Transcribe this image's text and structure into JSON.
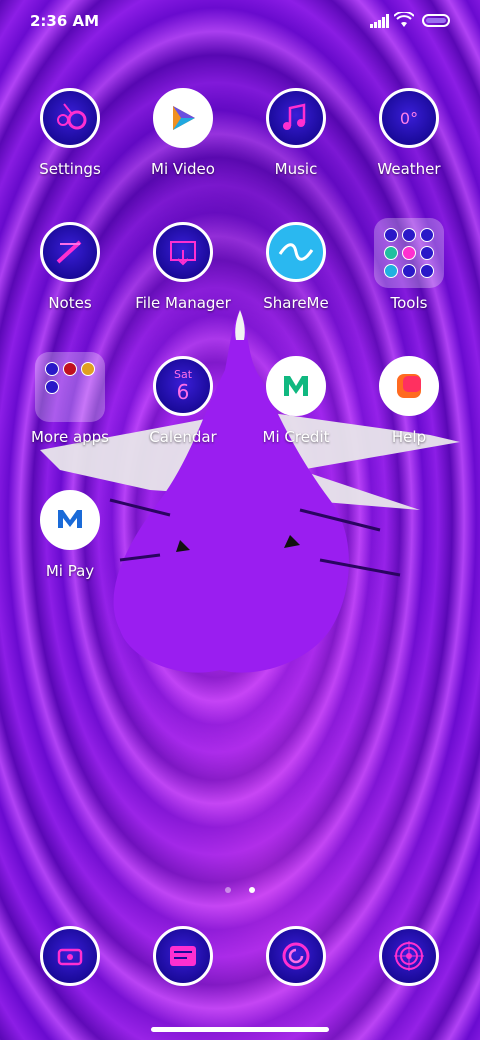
{
  "status_bar": {
    "time": "2:36 AM"
  },
  "apps_row1": [
    {
      "label": "Settings",
      "icon": "settings-icon"
    },
    {
      "label": "Mi Video",
      "icon": "mi-video-icon"
    },
    {
      "label": "Music",
      "icon": "music-icon"
    },
    {
      "label": "Weather",
      "icon": "weather-icon",
      "icon_text": "0°"
    }
  ],
  "apps_row2": [
    {
      "label": "Notes",
      "icon": "notes-icon"
    },
    {
      "label": "File Manager",
      "icon": "file-manager-icon"
    },
    {
      "label": "ShareMe",
      "icon": "shareme-icon"
    },
    {
      "label": "Tools",
      "icon": "folder-icon"
    }
  ],
  "apps_row3": [
    {
      "label": "More apps",
      "icon": "folder-icon"
    },
    {
      "label": "Calendar",
      "icon": "calendar-icon",
      "icon_day": "Sat",
      "icon_date": "6"
    },
    {
      "label": "Mi Credit",
      "icon": "mi-credit-icon"
    },
    {
      "label": "Help",
      "icon": "help-icon"
    }
  ],
  "apps_row4": [
    {
      "label": "Mi Pay",
      "icon": "mi-pay-icon"
    }
  ],
  "page_indicator": {
    "pages": 2,
    "current": 2
  },
  "dock": [
    {
      "icon": "phone-icon"
    },
    {
      "icon": "messages-icon"
    },
    {
      "icon": "browser-icon"
    },
    {
      "icon": "camera-icon"
    }
  ],
  "colors": {
    "accent": "#8c1ee6",
    "icon_bg": "#1a0a9a",
    "pink": "#ff2fd0"
  }
}
